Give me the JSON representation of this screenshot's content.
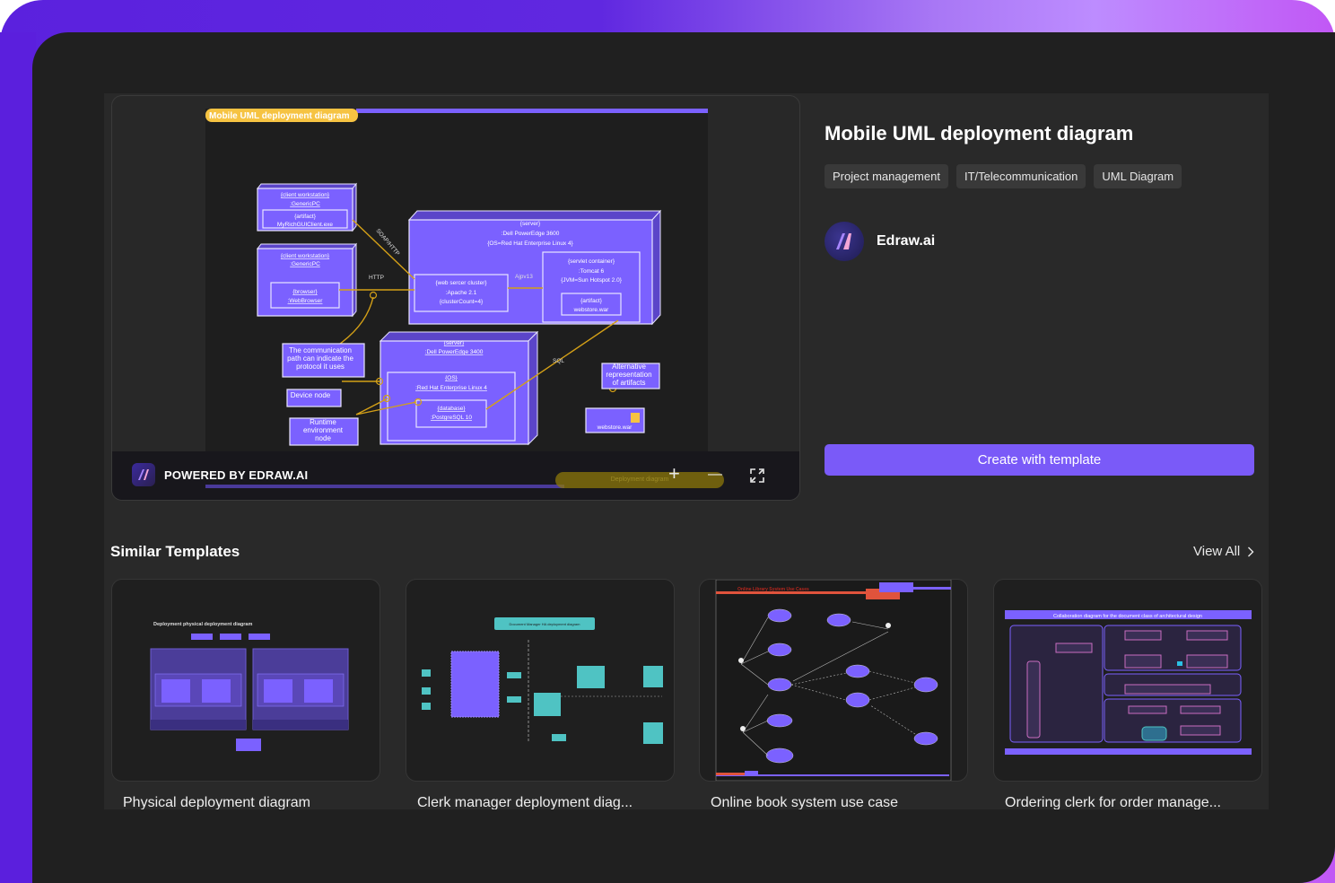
{
  "template": {
    "title": "Mobile UML deployment diagram",
    "tags": [
      "Project management",
      "IT/Telecommunication",
      "UML Diagram"
    ],
    "author": "Edraw.ai",
    "create_button": "Create with template"
  },
  "preview": {
    "powered_by": "POWERED BY EDRAW.AI",
    "minimap_label": "Deployment diagram",
    "controls": {
      "zoom_in": "+",
      "zoom_out": "—",
      "fullscreen": "fullscreen"
    },
    "diagram": {
      "title": "Mobile UML deployment diagram",
      "nodes": {
        "client1": {
          "stereotype": "{client workstation}",
          "name": ":GenericPC",
          "artifact_stereo": "{artifact}",
          "artifact_name": "MyRichGUIClient.exe"
        },
        "client2": {
          "stereotype": "{client workstation}",
          "name": ":GenericPC",
          "browser_stereo": "{browser}",
          "browser_name": ":WebBrowser"
        },
        "server1": {
          "stereotype": "{server}",
          "name": ":Dell PowerEdge 3600",
          "os": "{OS=Red Hat Enterprise Linux 4}"
        },
        "webcluster": {
          "stereotype": "{web sercer cluster}",
          "name": ":Apache 2.1",
          "count": "{clusterCount=4}"
        },
        "servlet": {
          "stereotype": "{servlet container}",
          "name": ":Tomcat 6",
          "jvm": "{JVM=Sun Hotspot 2.0}",
          "artifact_stereo": "{artifact}",
          "artifact_name": "webstore.war"
        },
        "server2": {
          "stereotype": "{server}",
          "name": ":Dell PowerEdge 3400"
        },
        "os": {
          "stereotype": "{OS}",
          "name": ":Red Hat Enterprise Linux 4"
        },
        "database": {
          "stereotype": "{database}",
          "name": ":PostgreSQL 10"
        },
        "artifact_alt": {
          "name": "webstore.war"
        }
      },
      "labels": {
        "soap": "SOAP/HTTP",
        "http": "HTTP",
        "ajp": "Ajpv13",
        "sql": "SQL"
      },
      "notes": {
        "comm": [
          "The communication",
          "path can indicate the",
          "protocol it uses"
        ],
        "device": "Device node",
        "runtime": [
          "Runtime",
          "environment",
          "node"
        ],
        "alt": [
          "Alternative",
          "representation",
          "of artifacts"
        ]
      }
    }
  },
  "similar": {
    "title": "Similar Templates",
    "view_all": "View All",
    "cards": [
      {
        "label": "Physical deployment diagram",
        "thumb_title": "Deployment physical deployment diagram"
      },
      {
        "label": "Clerk manager deployment diag...",
        "thumb_title": "Document Manager HA deployment diagram"
      },
      {
        "label": "Online book system use case",
        "thumb_title": "Online Library System Use Cases"
      },
      {
        "label": "Ordering clerk for order manage...",
        "thumb_title": "Collaboration diagram for the document class of architectural design"
      }
    ]
  },
  "colors": {
    "accent": "#7a5af8",
    "node": "#7b61ff",
    "connector": "#d4a017",
    "title_badge": "#f6c342"
  }
}
